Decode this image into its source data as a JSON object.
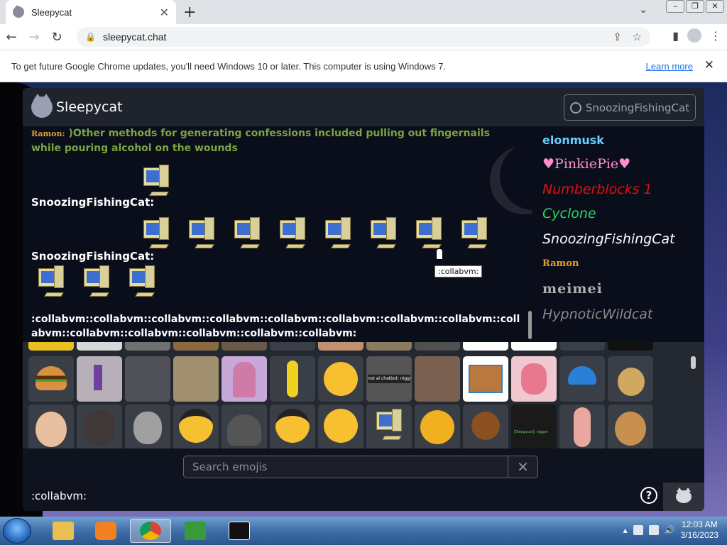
{
  "browser": {
    "tab_title": "Sleepycat",
    "tab_close": "✕",
    "new_tab": "+",
    "url": "sleepycat.chat",
    "infobar_text": "To get future Google Chrome updates, you'll need Windows 10 or later. This computer is using Windows 7.",
    "learn_more": "Learn more",
    "infobar_close": "✕"
  },
  "app": {
    "title": "Sleepycat",
    "user_button": "SnoozingFishingCat"
  },
  "chat": {
    "messages": [
      {
        "user": "Ramon:",
        "text": ")Other methods for generating confessions included pulling out fingernails while pouring alcohol on the wounds"
      },
      {
        "user": "SnoozingFishingCat:"
      },
      {
        "user": "SnoozingFishingCat:"
      }
    ],
    "code_text": ":collabvm::collabvm::collabvm::collabvm::collabvm::collabvm::collabvm::collabvm::collabvm::collabvm::collabvm::collabvm::collabvm::collabvm:",
    "tooltip": ":collabvm:"
  },
  "userlist": [
    "elonmusk",
    "PinkiePie",
    "Numberblocks 1",
    "Cyclone",
    "SnoozingFishingCat",
    "Ramon",
    "meimei",
    "HypnoticWildcat"
  ],
  "emoji": {
    "search_placeholder": "Search emojis",
    "clear": "✕",
    "row2_tile1_caption": "not ai chatbot: nigger",
    "row3_tile11_caption": "[Sleepycat]: nigger"
  },
  "input": {
    "typed": ":collabvm:",
    "help": "?"
  },
  "taskbar": {
    "time": "12:03 AM",
    "date": "3/16/2023"
  },
  "colors": {
    "accent_link": "#1a73e8",
    "chat_bg": "#0a0e1b",
    "panel_bg": "#242830"
  }
}
